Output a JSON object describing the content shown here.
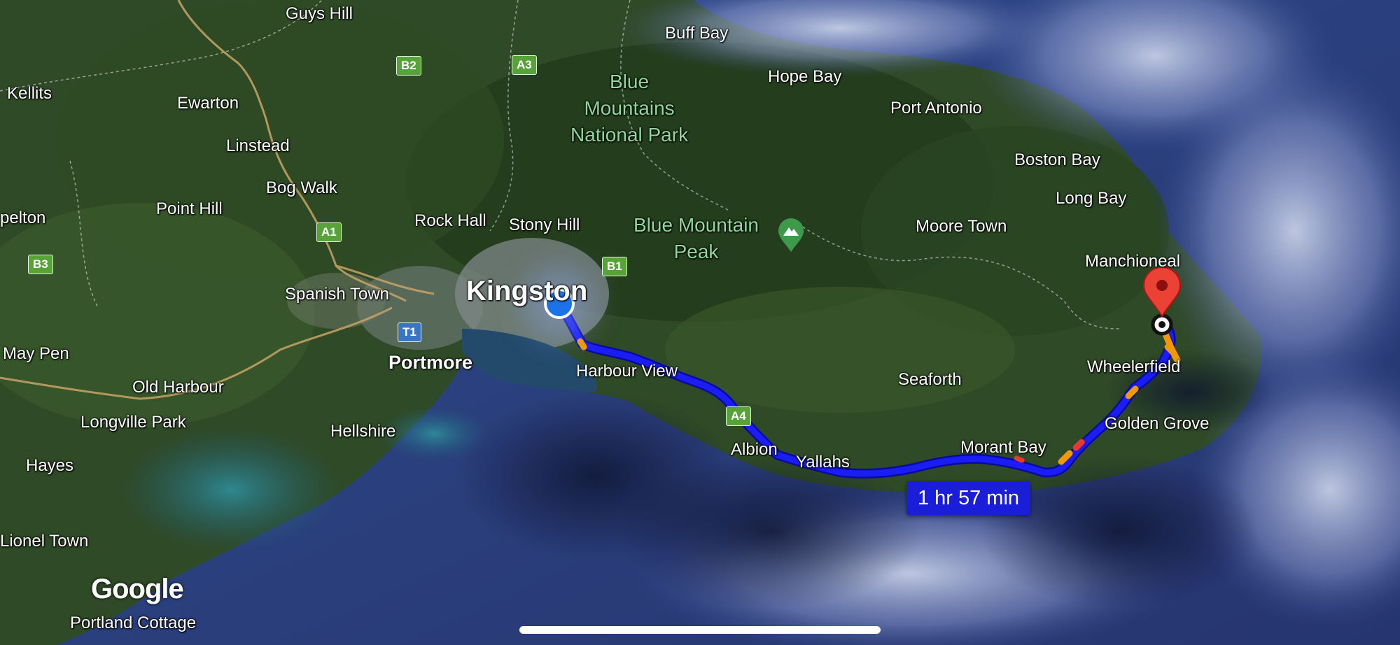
{
  "map": {
    "provider_logo": "Google",
    "view": "satellite",
    "colors": {
      "route": "#1a1ef5",
      "traffic_moderate": "#f29900",
      "traffic_heavy": "#e53935",
      "origin_dot": "#1a73e8",
      "destination_pin": "#ea4335",
      "duration_badge": "#1a1ed8",
      "park_label": "#8fd89a",
      "road_shield_green": "#58a23a",
      "road_shield_blue": "#3a74c4"
    },
    "route": {
      "duration": "1 hr 57 min",
      "origin": "Kingston",
      "origin_icon": "current-location-dot-icon",
      "destination_icon": "destination-pin-icon"
    },
    "labels": {
      "guys_hill": "Guys Hill",
      "buff_bay": "Buff Bay",
      "kellits": "Kellits",
      "ewarton": "Ewarton",
      "hope_bay": "Hope Bay",
      "port_antonio": "Port Antonio",
      "linstead": "Linstead",
      "boston_bay": "Boston Bay",
      "bog_walk": "Bog Walk",
      "point_hill": "Point Hill",
      "long_bay": "Long Bay",
      "pelton": "pelton",
      "rock_hall": "Rock Hall",
      "stony_hill": "Stony Hill",
      "moore_town": "Moore Town",
      "manchioneal": "Manchioneal",
      "spanish_town": "Spanish Town",
      "kingston": "Kingston",
      "may_pen": "May Pen",
      "portmore": "Portmore",
      "harbour_view": "Harbour View",
      "wheelerfield": "Wheelerfield",
      "seaforth": "Seaforth",
      "old_harbour": "Old Harbour",
      "longville_park": "Longville Park",
      "golden_grove": "Golden Grove",
      "hellshire": "Hellshire",
      "albion": "Albion",
      "morant_bay": "Morant Bay",
      "yallahs": "Yallahs",
      "hayes": "Hayes",
      "lionel_town": "Lionel Town",
      "portland_cottage": "Portland Cottage"
    },
    "park": {
      "name_line1": "Blue",
      "name_line2": "Mountains",
      "name_line3": "National Park"
    },
    "peak": {
      "name_line1": "Blue Mountain",
      "name_line2": "Peak",
      "icon": "mountain-peak-icon"
    },
    "shields": {
      "b2": "B2",
      "a3": "A3",
      "a1": "A1",
      "b1": "B1",
      "b3": "B3",
      "t1": "T1",
      "a4": "A4"
    }
  }
}
